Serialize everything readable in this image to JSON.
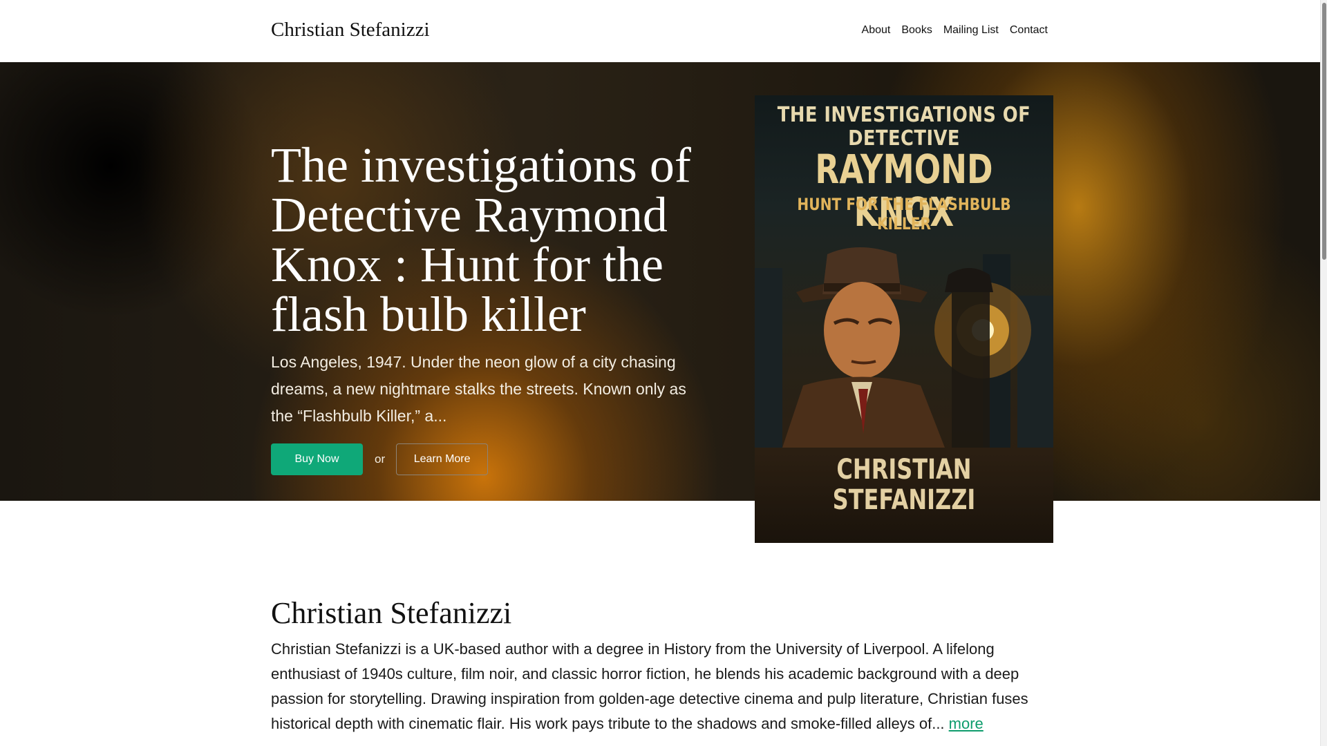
{
  "header": {
    "brand": "Christian Stefanizzi",
    "nav": [
      "About",
      "Books",
      "Mailing List",
      "Contact"
    ]
  },
  "hero": {
    "title": "The investigations of Detective Raymond Knox : Hunt for the flash bulb killer",
    "description": "Los Angeles, 1947. Under the neon glow of a city chasing dreams, a new nightmare stalks the streets. Known only as the “Flashbulb Killer,” a...",
    "buy_label": "Buy Now",
    "or_label": "or",
    "learn_label": "Learn More"
  },
  "cover": {
    "top_line": "THE INVESTIGATIONS OF DETECTIVE",
    "name": "RAYMOND KNOX",
    "subtitle": "HUNT FOR THE FLASHBULB KILLER",
    "author": "CHRISTIAN STEFANIZZI"
  },
  "about": {
    "title": "Christian Stefanizzi",
    "text": "Christian Stefanizzi is a UK-based author with a degree in History from the University of Liverpool. A lifelong enthusiast of 1940s culture, film noir, and classic horror fiction, he blends his academic background with a deep passion for storytelling. Drawing inspiration from golden-age detective cinema and pulp literature, Christian fuses historical depth with cinematic flair. His work pays tribute to the shadows and smoke-filled alleys of...",
    "more_label": "more"
  },
  "colors": {
    "accent": "#0fa878",
    "link": "#0e9c6c"
  }
}
